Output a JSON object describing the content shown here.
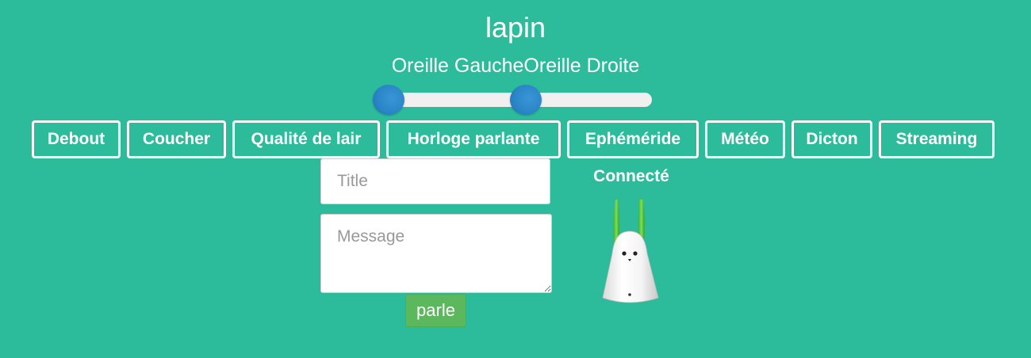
{
  "header": {
    "title": "lapin",
    "ears_label": "Oreille GaucheOreille Droite"
  },
  "ears": {
    "left_value": 0,
    "right_value": 0.5
  },
  "actions": [
    {
      "label": "Debout"
    },
    {
      "label": "Coucher"
    },
    {
      "label": "Qualité de lair"
    },
    {
      "label": "Horloge parlante"
    },
    {
      "label": "Ephéméride"
    },
    {
      "label": "Météo"
    },
    {
      "label": "Dicton"
    },
    {
      "label": "Streaming"
    }
  ],
  "form": {
    "title_placeholder": "Title",
    "message_placeholder": "Message",
    "send_label": "parle"
  },
  "status": {
    "text": "Connecté"
  },
  "colors": {
    "background": "#2cbc9b",
    "slider_handle": "#2b86c9",
    "send_button": "#5cb85c",
    "ear_green": "#5fcf3c"
  },
  "icons": {
    "rabbit": "nabaztag-rabbit-icon"
  }
}
